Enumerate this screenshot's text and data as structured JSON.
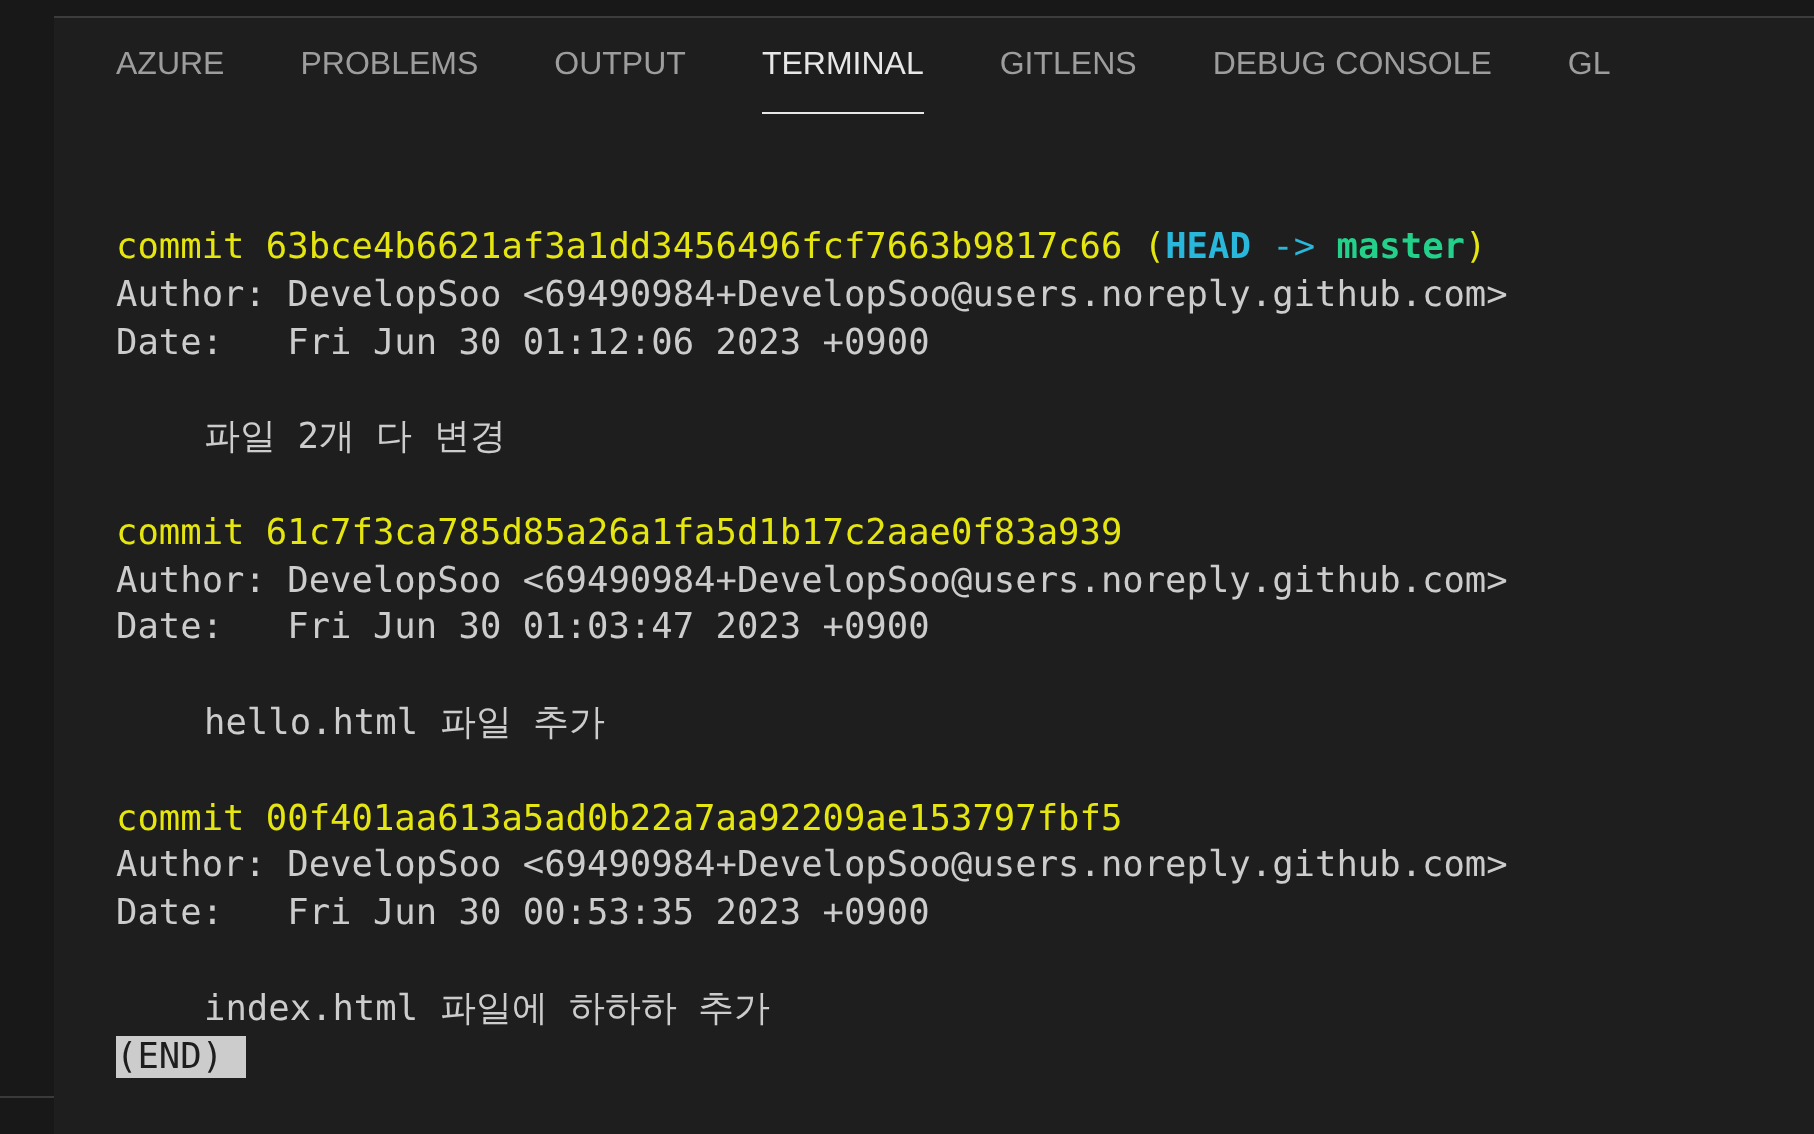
{
  "tabs": [
    {
      "label": "AZURE",
      "selected": false
    },
    {
      "label": "PROBLEMS",
      "selected": false
    },
    {
      "label": "OUTPUT",
      "selected": false
    },
    {
      "label": "TERMINAL",
      "selected": true
    },
    {
      "label": "GITLENS",
      "selected": false
    },
    {
      "label": "DEBUG CONSOLE",
      "selected": false
    },
    {
      "label": "GL",
      "selected": false
    }
  ],
  "terminal": {
    "commits": [
      {
        "commit": "commit 63bce4b6621af3a1dd3456496fcf7663b9817c66",
        "refs": {
          "open": "(",
          "head": "HEAD",
          "arrow": "->",
          "branch": "master",
          "close": ")"
        },
        "author": "Author: DevelopSoo <69490984+DevelopSoo@users.noreply.github.com>",
        "date": "Date:   Fri Jun 30 01:12:06 2023 +0900",
        "message": "파일 2개 다 변경"
      },
      {
        "commit": "commit 61c7f3ca785d85a26a1fa5d1b17c2aae0f83a939",
        "author": "Author: DevelopSoo <69490984+DevelopSoo@users.noreply.github.com>",
        "date": "Date:   Fri Jun 30 01:03:47 2023 +0900",
        "message": "hello.html 파일 추가"
      },
      {
        "commit": "commit 00f401aa613a5ad0b22a7aa92209ae153797fbf5",
        "author": "Author: DevelopSoo <69490984+DevelopSoo@users.noreply.github.com>",
        "date": "Date:   Fri Jun 30 00:53:35 2023 +0900",
        "message": "index.html 파일에 하하하 추가"
      }
    ],
    "end_marker": "(END)"
  }
}
